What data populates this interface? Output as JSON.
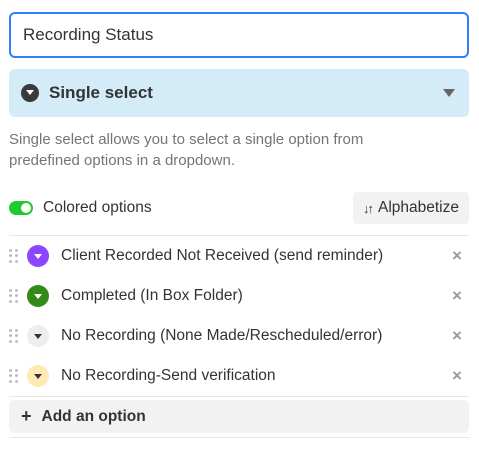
{
  "field": {
    "name_value": "Recording Status"
  },
  "type_select": {
    "label": "Single select",
    "icon": "chevron-circle-icon"
  },
  "description": "Single select allows you to select a single option from predefined options in a dropdown.",
  "colored_options": {
    "label": "Colored options",
    "enabled": true,
    "toggle_color": "#20c933"
  },
  "alphabetize": {
    "icon": "sort-arrows-icon",
    "label": "Alphabetize"
  },
  "options": [
    {
      "label": "Client Recorded Not Received (send reminder)",
      "color": "#8b46ff",
      "arrow": "light"
    },
    {
      "label": "Completed (In Box Folder)",
      "color": "#338a17",
      "arrow": "light"
    },
    {
      "label": "No Recording (None Made/Rescheduled/error)",
      "color": "#eeeeee",
      "arrow": "dark"
    },
    {
      "label": "No Recording-Send verification",
      "color": "#ffeab6",
      "arrow": "dark"
    }
  ],
  "add_option": {
    "label": "Add an option"
  },
  "colors": {
    "accent": "#2d7ff9",
    "type_bg": "#d4ecf8"
  }
}
